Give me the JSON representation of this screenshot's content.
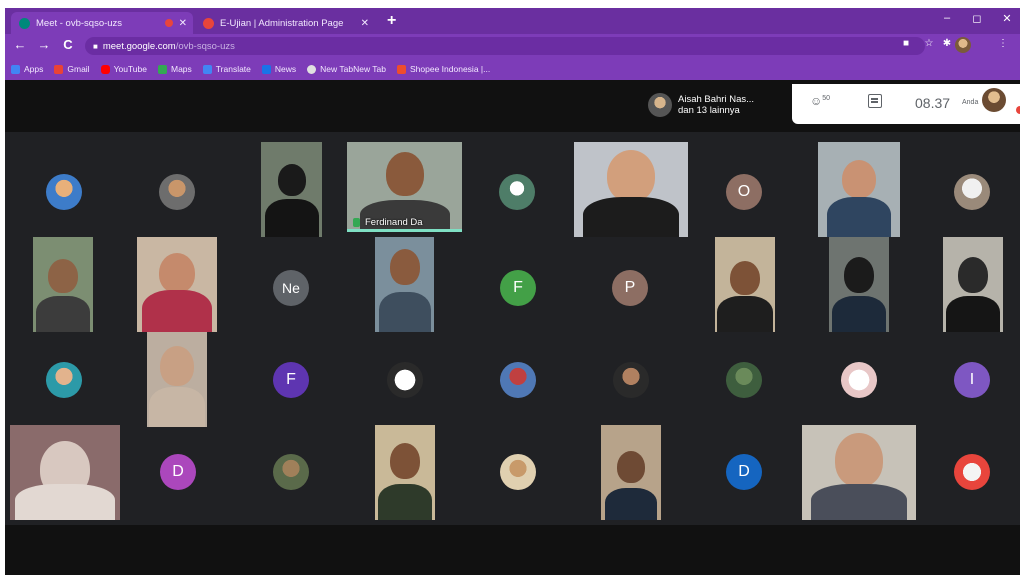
{
  "browser": {
    "tabs": [
      {
        "title": "Meet - ovb-sqso-uzs",
        "favicon_color": "#00897b",
        "active": true
      },
      {
        "title": "E-Ujian | Administration Page",
        "favicon_color": "#e8453c",
        "active": false
      }
    ],
    "window_controls": {
      "minimize": "–",
      "maximize": "◻",
      "close": "✕"
    },
    "address": {
      "host": "meet.google.com",
      "path": "/ovb-sqso-uzs"
    },
    "bookmarks": [
      {
        "label": "Apps",
        "color": "#4285f4"
      },
      {
        "label": "Gmail",
        "color": "#ea4335"
      },
      {
        "label": "YouTube",
        "color": "#ff0000"
      },
      {
        "label": "Maps",
        "color": "#34a853"
      },
      {
        "label": "Translate",
        "color": "#4285f4"
      },
      {
        "label": "News",
        "color": "#1a73e8"
      },
      {
        "label": "New TabNew Tab",
        "color": "#e0e0e0"
      },
      {
        "label": "Shopee Indonesia |...",
        "color": "#ee4d2d"
      }
    ]
  },
  "meet": {
    "notification": {
      "name": "Aisah Bahri Nas...",
      "subtitle": "dan 13 lainnya"
    },
    "people_count": "50",
    "time": "08.37",
    "self_label": "Anda",
    "active_speaker": "Ferdinand Da",
    "letter_avatars": {
      "o": "O",
      "ne": "Ne",
      "f1": "F",
      "p": "P",
      "f2": "F",
      "i": "I",
      "d1": "D",
      "d2": "D"
    }
  }
}
